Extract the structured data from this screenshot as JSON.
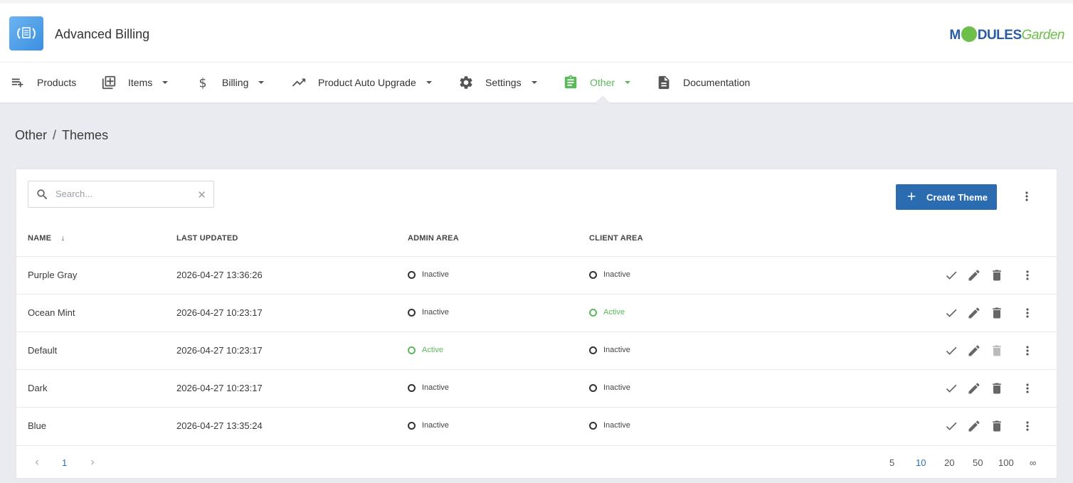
{
  "app": {
    "title": "Advanced Billing",
    "brand_left": "M",
    "brand_mid": "DULES",
    "brand_right": "Garden"
  },
  "nav": [
    {
      "label": "Products",
      "icon": "playlist-add-icon"
    },
    {
      "label": "Items",
      "icon": "library-add-icon"
    },
    {
      "label": "Billing",
      "icon": "dollar-icon"
    },
    {
      "label": "Product Auto Upgrade",
      "icon": "trending-up-icon"
    },
    {
      "label": "Settings",
      "icon": "gear-icon"
    },
    {
      "label": "Other",
      "icon": "clipboard-icon",
      "active": true
    },
    {
      "label": "Documentation",
      "icon": "document-icon"
    }
  ],
  "breadcrumb": {
    "parent": "Other",
    "separator": "/",
    "current": "Themes"
  },
  "toolbar": {
    "search_placeholder": "Search...",
    "search_value": "",
    "create_label": "Create Theme"
  },
  "table": {
    "columns": [
      "NAME",
      "LAST UPDATED",
      "ADMIN AREA",
      "CLIENT AREA"
    ],
    "sort_indicator": "↓",
    "rows": [
      {
        "name": "Purple Gray",
        "updated": "2026-04-27 13:36:26",
        "admin": "Inactive",
        "client": "Inactive"
      },
      {
        "name": "Ocean Mint",
        "updated": "2026-04-27 10:23:17",
        "admin": "Inactive",
        "client": "Active"
      },
      {
        "name": "Default",
        "updated": "2026-04-27 10:23:17",
        "admin": "Active",
        "client": "Inactive"
      },
      {
        "name": "Dark",
        "updated": "2026-04-27 10:23:17",
        "admin": "Inactive",
        "client": "Inactive"
      },
      {
        "name": "Blue",
        "updated": "2026-04-27 13:35:24",
        "admin": "Inactive",
        "client": "Inactive"
      }
    ]
  },
  "pagination": {
    "current_page": "1",
    "page_sizes": [
      "5",
      "10",
      "20",
      "50",
      "100",
      "∞"
    ],
    "selected_size": "10"
  },
  "colors": {
    "primary": "#2b6cb0",
    "active": "#5cb85c",
    "background": "#e9ebf0"
  }
}
